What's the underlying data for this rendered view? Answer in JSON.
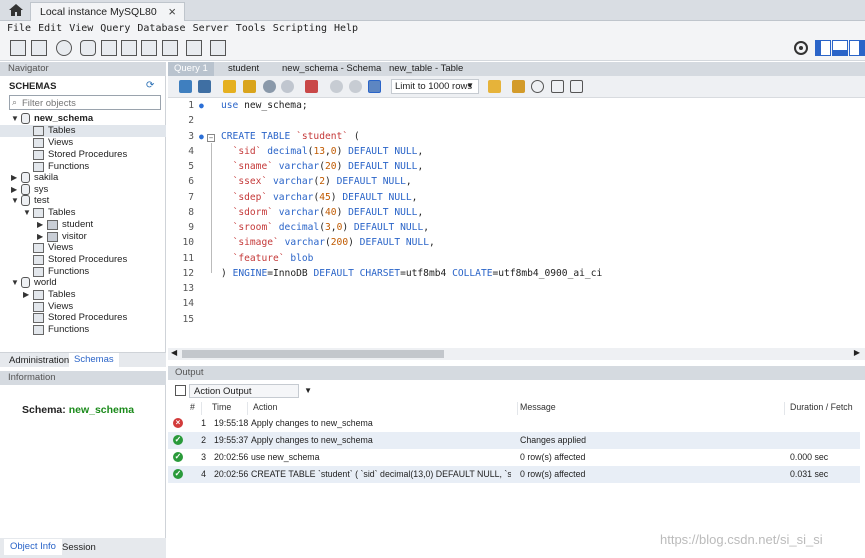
{
  "window": {
    "tab_title": "Local instance MySQL80",
    "close": "×"
  },
  "menu": [
    "File",
    "Edit",
    "View",
    "Query",
    "Database",
    "Server",
    "Tools",
    "Scripting",
    "Help"
  ],
  "navigator": {
    "header": "Navigator",
    "schemas_title": "SCHEMAS",
    "filter_placeholder": "Filter objects",
    "tree": {
      "new_schema": "new_schema",
      "tables": "Tables",
      "views": "Views",
      "stored_procedures": "Stored Procedures",
      "functions": "Functions",
      "sakila": "sakila",
      "sys": "sys",
      "test": "test",
      "student": "student",
      "visitor": "visitor",
      "world": "world"
    },
    "tabs": {
      "administration": "Administration",
      "schemas": "Schemas"
    }
  },
  "information": {
    "header": "Information",
    "schema_label": "Schema:",
    "schema_value": "new_schema",
    "tab_object": "Object Info",
    "tab_session": "Session"
  },
  "query_tabs": [
    "Query 1",
    "student",
    "new_schema - Schema",
    "new_table - Table"
  ],
  "limit": {
    "value": "Limit to 1000 rows"
  },
  "editor": {
    "lines": [
      "1",
      "2",
      "3",
      "4",
      "5",
      "6",
      "7",
      "8",
      "9",
      "10",
      "11",
      "12",
      "13",
      "14",
      "15"
    ]
  },
  "output": {
    "header": "Output",
    "action_select": "Action Output",
    "columns": [
      "#",
      "Time",
      "Action",
      "Message",
      "Duration / Fetch"
    ],
    "rows": [
      {
        "n": "1",
        "time": "19:55:18",
        "action": "Apply changes to new_schema",
        "message": "",
        "duration": "",
        "status": "error"
      },
      {
        "n": "2",
        "time": "19:55:37",
        "action": "Apply changes to new_schema",
        "message": "Changes applied",
        "duration": "",
        "status": "ok"
      },
      {
        "n": "3",
        "time": "20:02:56",
        "action": "use new_schema",
        "message": "0 row(s) affected",
        "duration": "0.000 sec",
        "status": "ok"
      },
      {
        "n": "4",
        "time": "20:02:56",
        "action": "CREATE TABLE `student` (  `sid` decimal(13,0) DEFAULT NULL,  `snam...",
        "message": "0 row(s) affected",
        "duration": "0.031 sec",
        "status": "ok"
      }
    ]
  },
  "watermark": "https://blog.csdn.net/si_si_si",
  "colors": {
    "accent": "#2a64c8",
    "ok": "#2a9a3a",
    "error": "#d23b3b",
    "schema_green": "#1a8a1a"
  }
}
